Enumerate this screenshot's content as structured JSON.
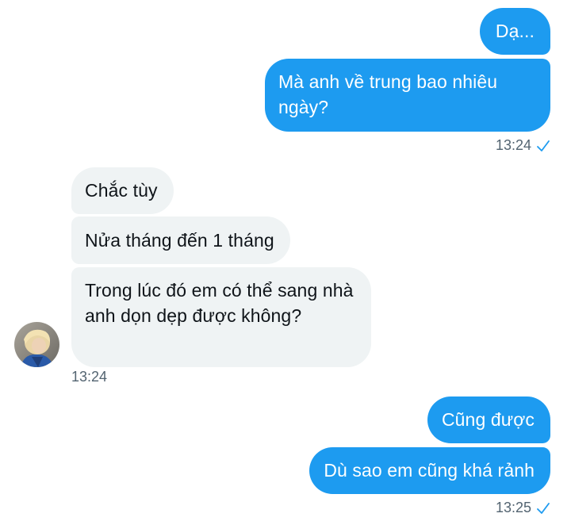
{
  "colors": {
    "outgoing_bubble": "#1d9bf0",
    "incoming_bubble": "#eff3f4",
    "timestamp": "#536471",
    "read_check": "#1d9bf0"
  },
  "conversation": {
    "group1": {
      "messages": [
        "Dạ...",
        "Mà anh về trung bao nhiêu ngày?"
      ],
      "time": "13:24",
      "status_icon": "check-icon"
    },
    "group2": {
      "messages": [
        "Chắc tùy",
        "Nửa tháng đến 1 tháng",
        "Trong lúc đó em có thể sang nhà anh dọn dẹp được không?"
      ],
      "time": "13:24",
      "avatar_icon": "user-avatar"
    },
    "group3": {
      "messages": [
        "Cũng được",
        "Dù sao em cũng khá rảnh"
      ],
      "time": "13:25",
      "status_icon": "check-icon"
    }
  }
}
